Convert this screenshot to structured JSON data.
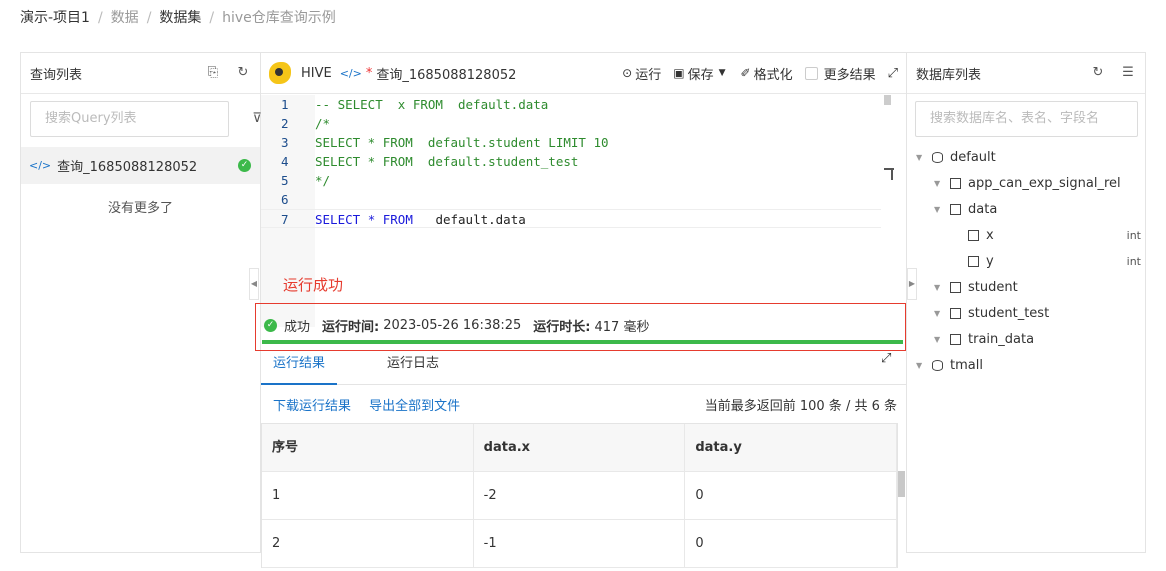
{
  "breadcrumb": [
    "演示-项目1",
    "数据",
    "数据集",
    "hive仓库查询示例"
  ],
  "left": {
    "title": "查询列表",
    "search_placeholder": "搜索Query列表",
    "items": [
      {
        "name": "查询_1685088128052"
      }
    ],
    "no_more": "没有更多了"
  },
  "toolbar": {
    "engine": "HIVE",
    "modified_mark": "*",
    "query_name": "查询_1685088128052",
    "run": "运行",
    "save": "保存",
    "format": "格式化",
    "more_results": "更多结果"
  },
  "editor": {
    "lines": [
      {
        "n": "1",
        "text": "-- SELECT  x FROM  default.data"
      },
      {
        "n": "2",
        "text": "/*"
      },
      {
        "n": "3",
        "text": "SELECT * FROM  default.student LIMIT 10"
      },
      {
        "n": "4",
        "text": "SELECT * FROM  default.student_test"
      },
      {
        "n": "5",
        "text": "*/"
      },
      {
        "n": "6",
        "text": ""
      },
      {
        "n": "7",
        "text": "SELECT * FROM   default.data"
      }
    ]
  },
  "annotation": "运行成功",
  "status": {
    "state": "成功",
    "time_label": "运行时间:",
    "time_value": "2023-05-26 16:38:25",
    "duration_label": "运行时长:",
    "duration_value": "417 毫秒",
    "progress": 1.0
  },
  "tabs": [
    "运行结果",
    "运行日志"
  ],
  "result_links": {
    "download": "下载运行结果",
    "export": "导出全部到文件"
  },
  "result_count": "当前最多返回前 100 条 / 共 6 条",
  "table": {
    "headers": [
      "序号",
      "data.x",
      "data.y"
    ],
    "rows": [
      [
        "1",
        "-2",
        "0"
      ],
      [
        "2",
        "-1",
        "0"
      ]
    ]
  },
  "right": {
    "title": "数据库列表",
    "search_placeholder": "搜索数据库名、表名、字段名",
    "tree": {
      "db1": "default",
      "t1": "app_can_exp_signal_rel",
      "t2": "data",
      "c1": {
        "name": "x",
        "type": "int"
      },
      "c2": {
        "name": "y",
        "type": "int"
      },
      "t3": "student",
      "t4": "student_test",
      "t5": "train_data",
      "db2": "tmall"
    }
  }
}
